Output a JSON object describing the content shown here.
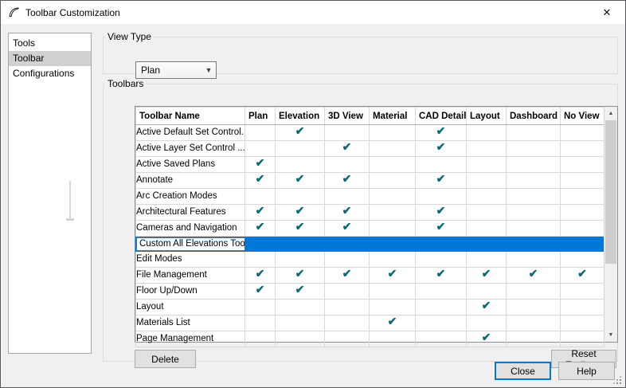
{
  "window": {
    "title": "Toolbar Customization"
  },
  "icons": {
    "close": "✕",
    "check": "✔",
    "dropdown_arrow": "▼",
    "scroll_up": "▲",
    "scroll_down": "▼"
  },
  "sidebar": {
    "items": [
      {
        "label": "Tools",
        "selected": false
      },
      {
        "label": "Toolbar",
        "selected": true
      },
      {
        "label": "Configurations",
        "selected": false
      }
    ]
  },
  "view_type": {
    "group_label": "View Type",
    "selected_option": "Plan"
  },
  "toolbars": {
    "group_label": "Toolbars",
    "columns": [
      "Toolbar Name",
      "Plan",
      "Elevation",
      "3D View",
      "Material",
      "CAD Detail",
      "Layout",
      "Dashboard",
      "No View"
    ],
    "rows": [
      {
        "name": "Active Default Set Control...",
        "checks": [
          false,
          true,
          false,
          false,
          true,
          false,
          false,
          false
        ],
        "selected": false,
        "editing": false
      },
      {
        "name": "Active Layer Set Control ...",
        "checks": [
          false,
          false,
          true,
          false,
          true,
          false,
          false,
          false
        ],
        "selected": false,
        "editing": false
      },
      {
        "name": "Active Saved Plans",
        "checks": [
          true,
          false,
          false,
          false,
          false,
          false,
          false,
          false
        ],
        "selected": false,
        "editing": false
      },
      {
        "name": "Annotate",
        "checks": [
          true,
          true,
          true,
          false,
          true,
          false,
          false,
          false
        ],
        "selected": false,
        "editing": false
      },
      {
        "name": "Arc Creation Modes",
        "checks": [
          false,
          false,
          false,
          false,
          false,
          false,
          false,
          false
        ],
        "selected": false,
        "editing": false
      },
      {
        "name": "Architectural Features",
        "checks": [
          true,
          true,
          true,
          false,
          true,
          false,
          false,
          false
        ],
        "selected": false,
        "editing": false
      },
      {
        "name": "Cameras and Navigation",
        "checks": [
          true,
          true,
          true,
          false,
          true,
          false,
          false,
          false
        ],
        "selected": false,
        "editing": false
      },
      {
        "name": "Custom All Elevations Toolbar",
        "checks": [
          false,
          false,
          false,
          false,
          false,
          false,
          false,
          false
        ],
        "selected": true,
        "editing": true
      },
      {
        "name": "Edit Modes",
        "checks": [
          false,
          false,
          false,
          false,
          false,
          false,
          false,
          false
        ],
        "selected": false,
        "editing": false
      },
      {
        "name": "File Management",
        "checks": [
          true,
          true,
          true,
          true,
          true,
          true,
          true,
          true
        ],
        "selected": false,
        "editing": false
      },
      {
        "name": "Floor Up/Down",
        "checks": [
          true,
          true,
          false,
          false,
          false,
          false,
          false,
          false
        ],
        "selected": false,
        "editing": false
      },
      {
        "name": "Layout",
        "checks": [
          false,
          false,
          false,
          false,
          false,
          true,
          false,
          false
        ],
        "selected": false,
        "editing": false
      },
      {
        "name": "Materials List",
        "checks": [
          false,
          false,
          false,
          true,
          false,
          false,
          false,
          false
        ],
        "selected": false,
        "editing": false
      },
      {
        "name": "Page Management",
        "checks": [
          false,
          false,
          false,
          false,
          false,
          true,
          false,
          false
        ],
        "selected": false,
        "editing": false
      }
    ],
    "delete_label": "Delete",
    "reset_label": "Reset Toolbars"
  },
  "footer": {
    "close_label": "Close",
    "help_label": "Help"
  },
  "colors": {
    "selection": "#0078d7",
    "check": "#0f6878",
    "selected_text": "#ffffff"
  }
}
